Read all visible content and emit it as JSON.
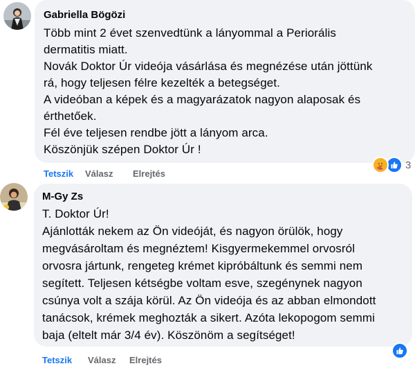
{
  "comments": [
    {
      "author": "Gabriella Bögözi",
      "lines": [
        "Több mint 2 évet szenvedtünk a lányommal a Periorális",
        "dermatitis miatt.",
        "Novák Doktor Úr videója vásárlása és megnézése után jöttünk",
        "rá, hogy teljesen félre kezelték a betegséget.",
        "A videóban a képek és a magyarázatok nagyon alaposak és",
        "érthetőek.",
        "Fél éve teljesen rendbe jött a lányom arca.",
        "Köszönjük szépen Doktor Úr !"
      ],
      "actions": {
        "like": "Tetszik",
        "reply": "Válasz",
        "hide": "Elrejtés"
      },
      "reactions": {
        "icons": [
          "care-icon",
          "like-icon"
        ],
        "count": "3"
      }
    },
    {
      "author": "M-Gy Zs",
      "lines": [
        "T. Doktor Úr!",
        "Ajánlották nekem az Ön videóját, és nagyon örülök, hogy",
        "megvásároltam és megnéztem! Kisgyermekemmel orvosról",
        "orvosra jártunk, rengeteg krémet kipróbáltunk és semmi nem",
        "segített. Teljesen kétségbe voltam esve, szegénynek nagyon",
        "csúnya volt a szája körül. Az Ön videója és az abban elmondott",
        "tanácsok, krémek meghozták a sikert. Azóta lekopogom semmi",
        "baja (eltelt már 3/4 év). Köszönöm a segítséget!"
      ],
      "actions": {
        "like": "Tetszik",
        "reply": "Válasz",
        "hide": "Elrejtés"
      },
      "reactions": {
        "icons": [
          "like-icon"
        ]
      }
    }
  ],
  "colors": {
    "bubble": "#f0f2f5",
    "link_blue": "#1877f2",
    "meta_grey": "#65676b"
  }
}
